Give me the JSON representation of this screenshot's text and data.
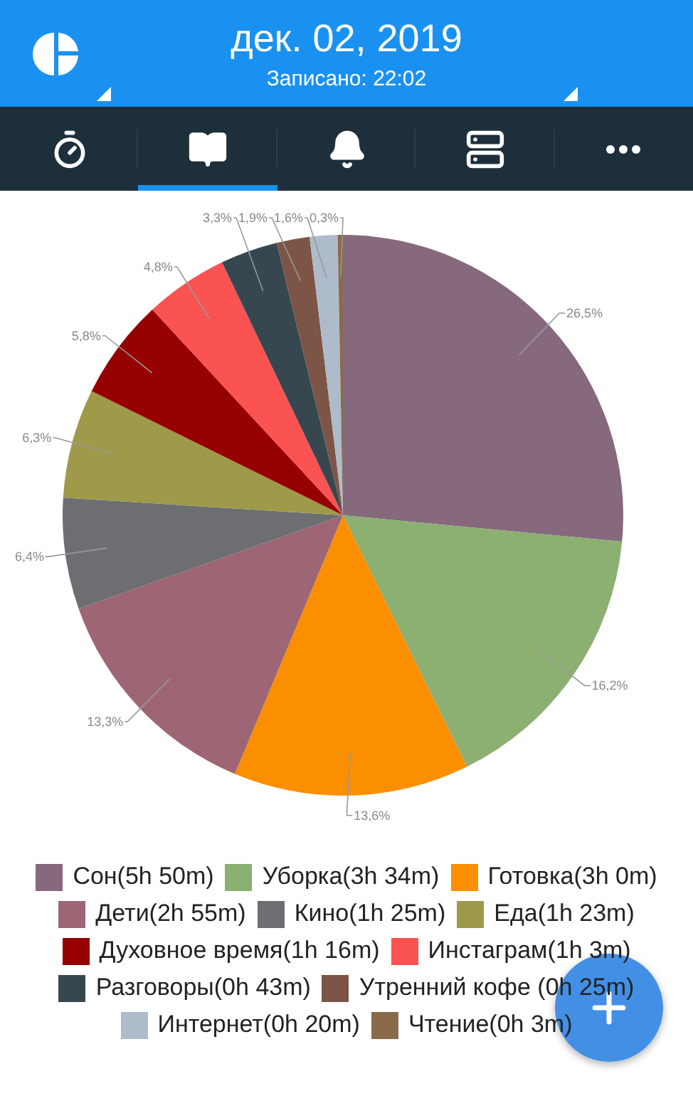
{
  "header": {
    "date": "дек. 02, 2019",
    "subtitle": "Записано: 22:02"
  },
  "tabs": [
    {
      "kind": "timer",
      "selected": false
    },
    {
      "kind": "book",
      "selected": true
    },
    {
      "kind": "bell",
      "selected": false
    },
    {
      "kind": "list",
      "selected": false
    },
    {
      "kind": "more",
      "selected": false
    }
  ],
  "chart": {
    "chart_data": {
      "type": "pie",
      "values": [
        26.5,
        16.2,
        13.6,
        13.3,
        6.4,
        6.3,
        5.8,
        4.8,
        3.3,
        1.9,
        1.6,
        0.3
      ],
      "value_labels": [
        "26,5%",
        "16,2%",
        "13,6%",
        "13,3%",
        "6,4%",
        "6,3%",
        "5,8%",
        "4,8%",
        "3,3%",
        "1,9%",
        "1,6%",
        "0,3%"
      ],
      "data_labels": true
    },
    "legend": [
      {
        "label": "Сон(5h 50m)",
        "color": "#86697c"
      },
      {
        "label": "Уборка(3h 34m)",
        "color": "#8caf72"
      },
      {
        "label": "Готовка(3h 0m)",
        "color": "#fb8f00"
      },
      {
        "label": "Дети(2h 55m)",
        "color": "#9e6674"
      },
      {
        "label": "Кино(1h 25m)",
        "color": "#6c6e72"
      },
      {
        "label": "Еда(1h 23m)",
        "color": "#9e9a4a"
      },
      {
        "label": "Духовное время(1h 16m)",
        "color": "#960000"
      },
      {
        "label": "Инстаграм(1h 3m)",
        "color": "#fb5252"
      },
      {
        "label": "Разговоры(0h 43m)",
        "color": "#37474f"
      },
      {
        "label": "Утренний кофе (0h 25m)",
        "color": "#7c5546"
      },
      {
        "label": "Интернет(0h 20m)",
        "color": "#adbbcb"
      },
      {
        "label": "Чтение(0h 3m)",
        "color": "#896a4a"
      }
    ]
  }
}
